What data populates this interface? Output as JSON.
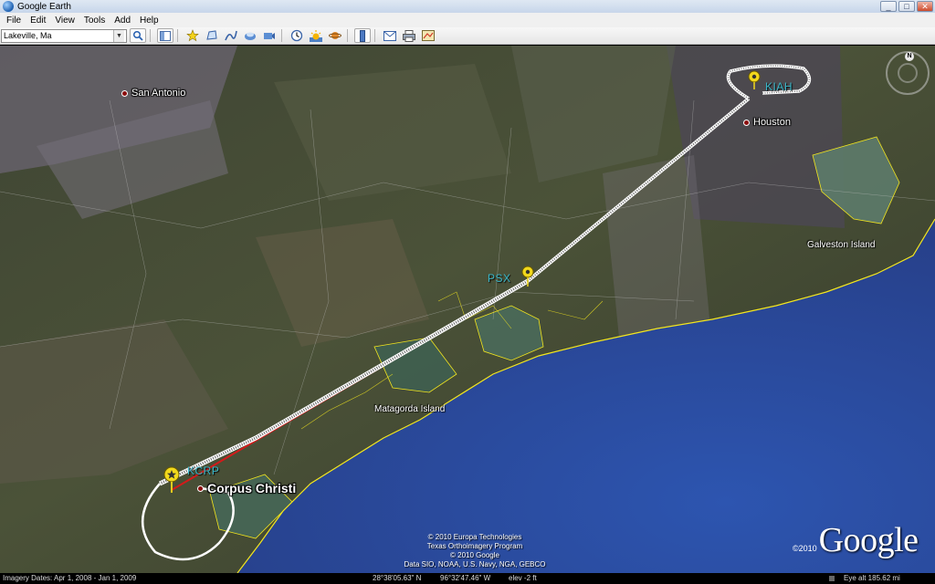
{
  "window": {
    "title": "Google Earth",
    "buttons": [
      "_",
      "□",
      "✕"
    ]
  },
  "menu": [
    "File",
    "Edit",
    "View",
    "Tools",
    "Add",
    "Help"
  ],
  "toolbar": {
    "search_value": "Lakeville, Ma",
    "icons": [
      "search-icon",
      "sidebar-icon",
      "placemark-icon",
      "polygon-icon",
      "path-icon",
      "image-overlay-icon",
      "record-tour-icon",
      "historical-imagery-icon",
      "sun-icon",
      "planets-icon",
      "ruler-icon",
      "email-icon",
      "print-icon",
      "maps-icon"
    ]
  },
  "map": {
    "places": {
      "san_antonio": "San Antonio",
      "houston": "Houston",
      "corpus_christi": "Corpus Christi",
      "galveston_island": "Galveston Island",
      "matagorda_island": "Matagorda Island"
    },
    "airports": {
      "kiah": "KIAH",
      "psx": "PSX",
      "kcrp": "KCRP"
    },
    "compass_north": "N",
    "copyright_lines": [
      "© 2010 Europa Technologies",
      "Texas Orthoimagery Program",
      "© 2010 Google",
      "Data SIO, NOAA, U.S. Navy, NGA, GEBCO"
    ],
    "logo_year": "©2010",
    "logo_word": "Google"
  },
  "status": {
    "imagery_dates": "Imagery Dates: Apr 1, 2008 - Jan 1, 2009",
    "lat": "28°38'05.63\" N",
    "lon": "96°32'47.46\" W",
    "elev": "elev   -2 ft",
    "eye_alt": "Eye alt  185.62 mi"
  },
  "colors": {
    "flight_path": "#ffffff",
    "direct_route": "#d41a1a",
    "coastline": "#f3e61e",
    "ocean": "#2b4a9e",
    "marker": "#f2d91c"
  }
}
